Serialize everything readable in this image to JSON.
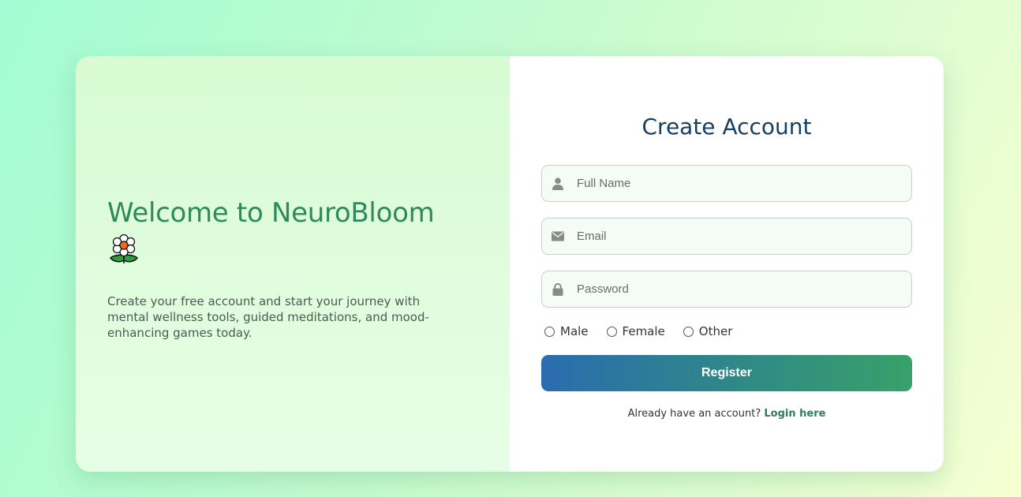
{
  "welcome": {
    "title": "Welcome to NeuroBloom",
    "emoji_icon": "flower-icon",
    "description": "Create your free account and start your journey with mental wellness tools, guided meditations, and mood-enhancing games today."
  },
  "form": {
    "title": "Create Account",
    "fields": {
      "full_name": {
        "placeholder": "Full Name",
        "value": "",
        "icon": "user-icon"
      },
      "email": {
        "placeholder": "Email",
        "value": "",
        "icon": "envelope-icon"
      },
      "password": {
        "placeholder": "Password",
        "value": "",
        "icon": "lock-icon"
      }
    },
    "gender_options": [
      "Male",
      "Female",
      "Other"
    ],
    "register_label": "Register",
    "login_prompt": "Already have an account?",
    "login_link": "Login here"
  },
  "colors": {
    "title_green": "#2e8a5c",
    "heading_navy": "#173f63",
    "button_start": "#2b6cb0",
    "button_end": "#38a169",
    "link_green": "#2e7d5b"
  }
}
